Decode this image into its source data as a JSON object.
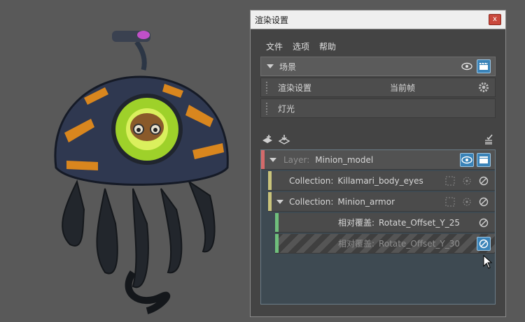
{
  "window": {
    "title": "渲染设置",
    "close_glyph": "x"
  },
  "menu": [
    "文件",
    "选项",
    "帮助"
  ],
  "scene": {
    "label": "场景"
  },
  "render_settings": {
    "label": "渲染设置",
    "value": "当前帧"
  },
  "lights": {
    "label": "灯光"
  },
  "layer": {
    "prefix": "Layer:",
    "name": "Minion_model",
    "color": "#d46a6a"
  },
  "collections": [
    {
      "prefix": "Collection:",
      "name": "Killamari_body_eyes",
      "color": "#c9c47c"
    },
    {
      "prefix": "Collection:",
      "name": "Minion_armor",
      "color": "#c9c47c"
    }
  ],
  "overrides": [
    {
      "prefix": "相对覆盖:",
      "name": "Rotate_Offset_Y_25",
      "color": "#6fbf7c"
    },
    {
      "prefix": "相对覆盖:",
      "name": "Rotate_Offset_Y_30",
      "color": "#6fbf7c"
    }
  ]
}
